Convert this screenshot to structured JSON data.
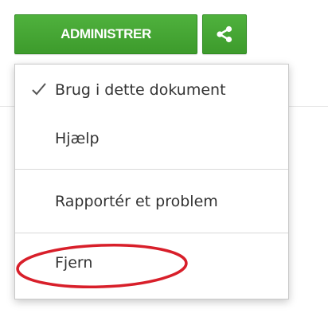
{
  "toolbar": {
    "admin_label": "ADMINISTRER",
    "share_icon": "share-icon",
    "accent_color": "#3fa42f"
  },
  "menu": {
    "items": [
      {
        "label": "Brug i dette dokument",
        "checked": true
      },
      {
        "label": "Hjælp",
        "checked": false
      },
      {
        "label": "Rapportér et problem",
        "checked": false
      },
      {
        "label": "Fjern",
        "checked": false
      }
    ]
  },
  "annotation": {
    "highlight_color": "#d81f2a",
    "highlighted_item": "Fjern"
  }
}
